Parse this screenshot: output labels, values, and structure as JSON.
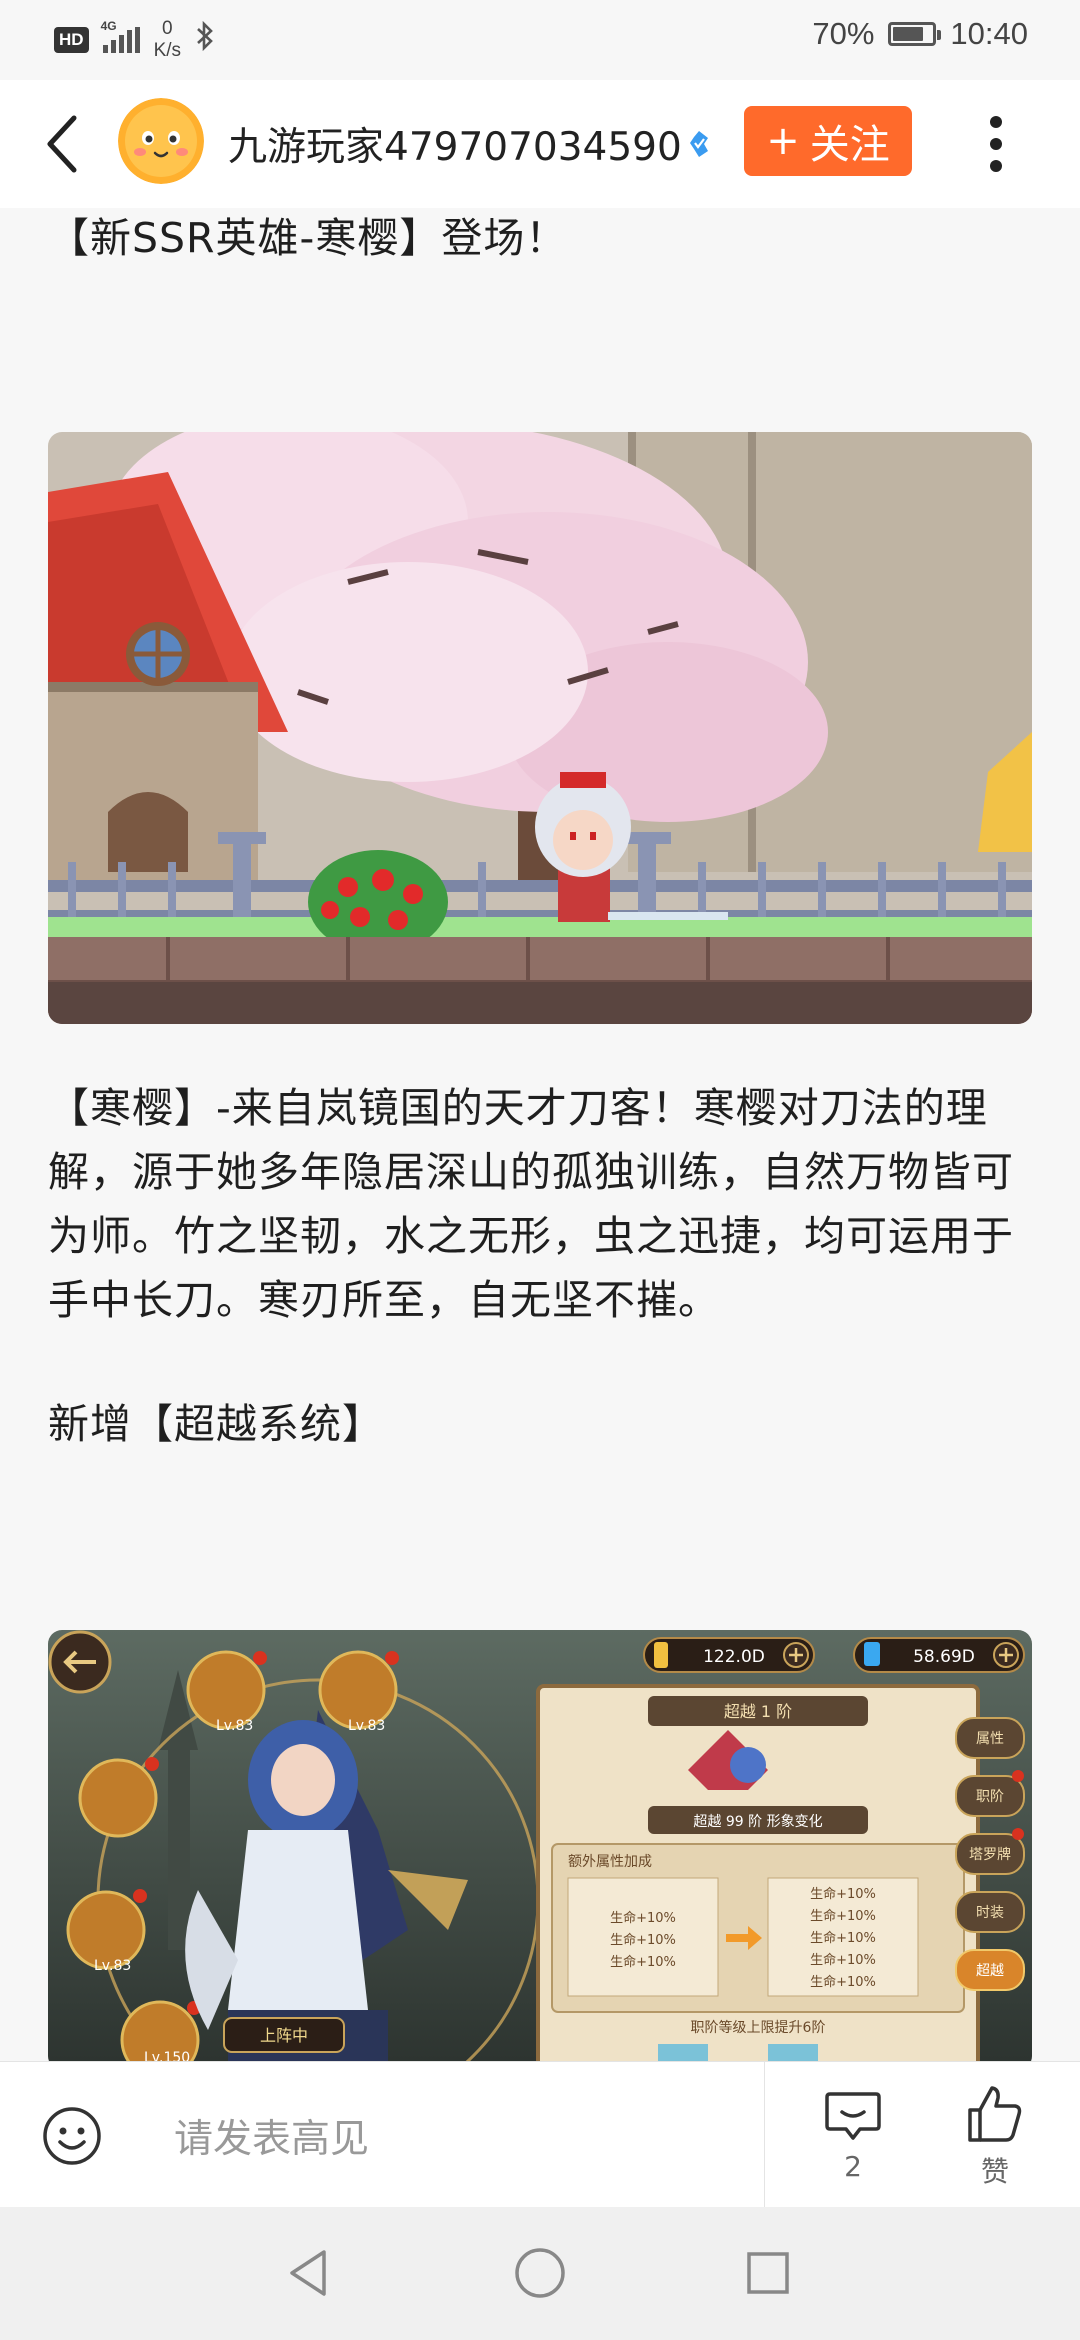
{
  "status_bar": {
    "hd": "HD",
    "network": "4G",
    "speed_value": "0",
    "speed_unit": "K/s",
    "battery": "70%",
    "time": "10:40",
    "icons": [
      "signal-icon",
      "bluetooth-icon",
      "battery-icon"
    ]
  },
  "header": {
    "author": "九游玩家479707034590",
    "follow_label": "关注",
    "follow_plus": "+",
    "icons": [
      "back-arrow-icon",
      "avatar-emoji",
      "verified-icon",
      "more-vertical-icon"
    ]
  },
  "article": {
    "headline": "【新SSR英雄-寒樱】登场！",
    "description": "【寒樱】-来自岚镜国的天才刀客！寒樱对刀法的理解，源于她多年隐居深山的孤独训练，自然万物皆可为师。竹之坚韧，水之无形，虫之迅捷，均可运用于手中长刀。寒刃所至，自无坚不摧。",
    "new_system": "新增【超越系统】",
    "image2": {
      "gold": "122.0D",
      "gems": "58.69D",
      "panel_title": "超越 1 阶",
      "tier_caption": "超越 99 阶 形象变化",
      "bonus_title": "额外属性加成",
      "bonus_left": [
        "生命+10%",
        "生命+10%",
        "生命+10%"
      ],
      "bonus_right": [
        "生命+10%",
        "生命+10%",
        "生命+10%",
        "生命+10%",
        "生命+10%"
      ],
      "footer": "职阶等级上限提升6阶",
      "tabs": [
        "属性",
        "职阶",
        "塔罗牌",
        "时装",
        "超越"
      ],
      "levels": [
        "Lv.83",
        "Lv.83",
        "Lv.83",
        "Lv.150"
      ],
      "deploy": "上阵中"
    }
  },
  "comment_bar": {
    "placeholder": "请发表高见",
    "comment_count": "2",
    "like_label": "赞"
  },
  "colors": {
    "accent": "#ff6a2b",
    "background": "#f7f7f7",
    "text": "#1f1f1f"
  }
}
